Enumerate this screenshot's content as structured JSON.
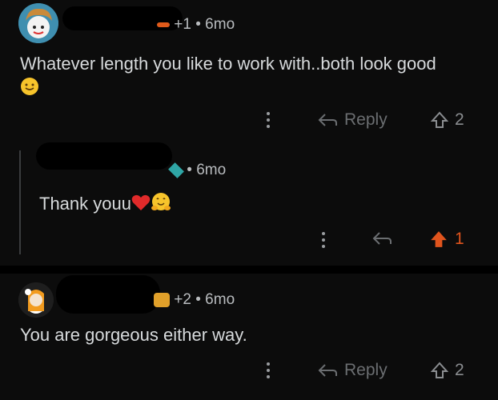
{
  "comments": [
    {
      "user_flair": "+1",
      "time": "6mo",
      "text": "Whatever length you like to work with..both look good",
      "reply_label": "Reply",
      "votes": "2"
    },
    {
      "time": "6mo",
      "text": "Thank youu",
      "votes": "1",
      "upvoted": true
    },
    {
      "user_flair": "+2",
      "time": "6mo",
      "text": "You are gorgeous either way.",
      "reply_label": "Reply",
      "votes": "2"
    }
  ],
  "colors": {
    "background": "#0c0c0c",
    "text": "#d7dadc",
    "muted": "#6b6e71",
    "upvote": "#e0541d"
  },
  "icons": [
    "more-dots-icon",
    "reply-arrow-icon",
    "upvote-arrow-icon",
    "heart-emoji",
    "hugging-face-emoji",
    "smiley-emoji",
    "award-icon"
  ]
}
